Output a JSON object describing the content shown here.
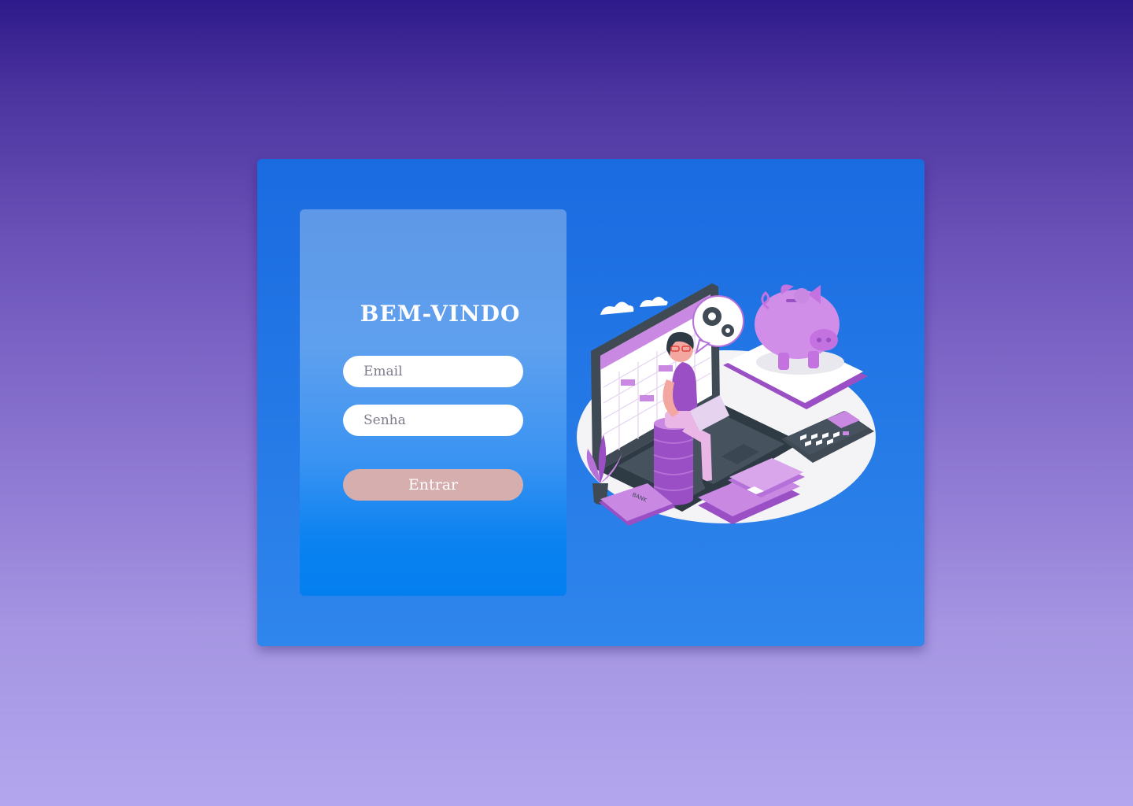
{
  "login": {
    "title": "BEM-VINDO",
    "email_placeholder": "Email",
    "password_placeholder": "Senha",
    "submit_label": "Entrar"
  },
  "illustration": {
    "card_label": "BANK",
    "icons": [
      "cloud-icon",
      "gear-icon",
      "piggy-bank-icon",
      "calculator-icon",
      "banknote-icon",
      "credit-card-icon",
      "plant-icon",
      "laptop-icon",
      "coin-stack-icon"
    ]
  },
  "colors": {
    "card": "#1a6be0",
    "button": "#d7aeae",
    "accent_purple": "#b571d8"
  }
}
